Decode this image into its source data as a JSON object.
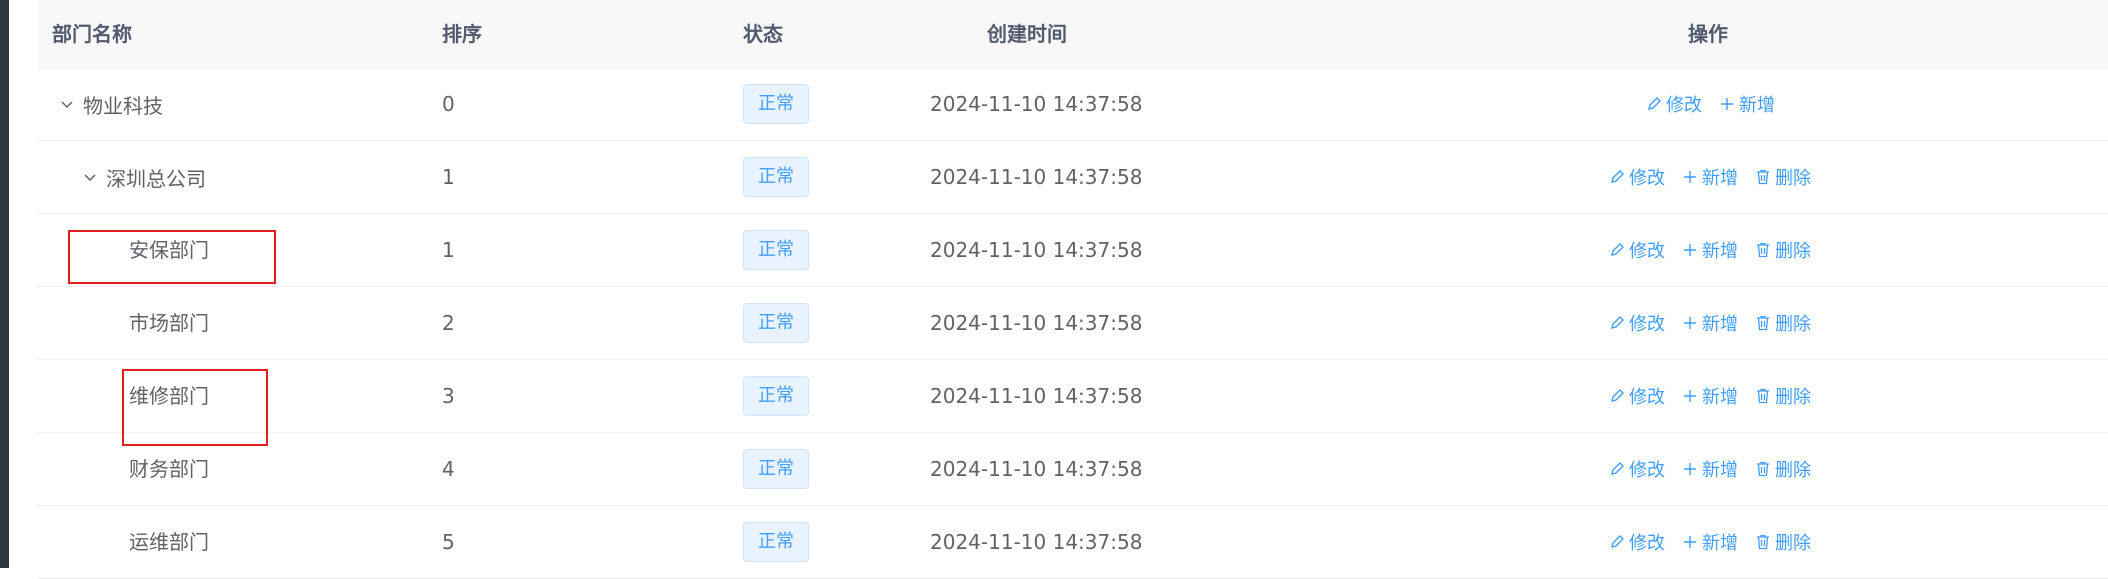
{
  "table": {
    "columns": {
      "name": "部门名称",
      "order": "排序",
      "status": "状态",
      "created": "创建时间",
      "actions": "操作"
    },
    "rows": [
      {
        "name": "物业科技",
        "order": "0",
        "status": "正常",
        "created": "2024-11-10 14:37:58",
        "expanded": true,
        "actions": [
          "修改",
          "新增"
        ]
      },
      {
        "name": "深圳总公司",
        "order": "1",
        "status": "正常",
        "created": "2024-11-10 14:37:58",
        "expanded": true,
        "actions": [
          "修改",
          "新增",
          "删除"
        ]
      },
      {
        "name": "安保部门",
        "order": "1",
        "status": "正常",
        "created": "2024-11-10 14:37:58",
        "actions": [
          "修改",
          "新增",
          "删除"
        ]
      },
      {
        "name": "市场部门",
        "order": "2",
        "status": "正常",
        "created": "2024-11-10 14:37:58",
        "actions": [
          "修改",
          "新增",
          "删除"
        ]
      },
      {
        "name": "维修部门",
        "order": "3",
        "status": "正常",
        "created": "2024-11-10 14:37:58",
        "actions": [
          "修改",
          "新增",
          "删除"
        ]
      },
      {
        "name": "财务部门",
        "order": "4",
        "status": "正常",
        "created": "2024-11-10 14:37:58",
        "actions": [
          "修改",
          "新增",
          "删除"
        ]
      },
      {
        "name": "运维部门",
        "order": "5",
        "status": "正常",
        "created": "2024-11-10 14:37:58",
        "actions": [
          "修改",
          "新增",
          "删除"
        ]
      }
    ]
  },
  "icons": {
    "expand": "chevron-down-icon",
    "edit": "edit-icon",
    "add": "plus-icon",
    "delete": "trash-icon"
  },
  "colors": {
    "primary": "#409eff",
    "header_bg": "#f8f8f9",
    "highlight": "#e02020",
    "sidebar": "#2e3440"
  }
}
